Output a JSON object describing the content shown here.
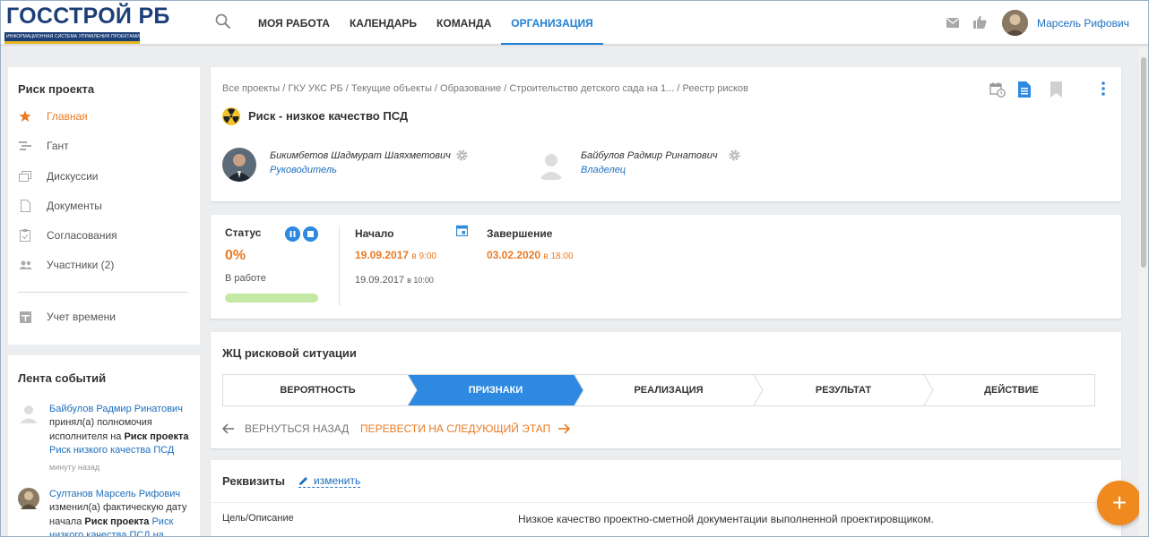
{
  "header": {
    "logo_title": "ГОССТРОЙ РБ",
    "logo_subtitle": "ИНФОРМАЦИОННАЯ СИСТЕМА УПРАВЛЕНИЯ ПРОЕКТАМИ",
    "nav": [
      {
        "label": "Моя работа"
      },
      {
        "label": "Календарь"
      },
      {
        "label": "Команда"
      },
      {
        "label": "Организация",
        "active": true
      }
    ],
    "user_name": "Марсель Рифович"
  },
  "sidebar": {
    "title": "Риск проекта",
    "items": [
      {
        "label": "Главная",
        "icon": "star-icon",
        "active": true
      },
      {
        "label": "Гант",
        "icon": "gantt-icon"
      },
      {
        "label": "Дискуссии",
        "icon": "discussions-icon"
      },
      {
        "label": "Документы",
        "icon": "documents-icon"
      },
      {
        "label": "Согласования",
        "icon": "approvals-icon"
      },
      {
        "label": "Участники (2)",
        "icon": "participants-icon"
      }
    ],
    "time_item": {
      "label": "Учет времени",
      "icon": "time-tracking-icon"
    }
  },
  "feed": {
    "title": "Лента событий",
    "items": [
      {
        "author": "Байбулов Радмир Ринатович",
        "action": "принял(а) полномочия исполнителя на",
        "object_type": "Риск проекта",
        "object": "Риск низкого качества ПСД",
        "time": "минуту назад"
      },
      {
        "author": "Султанов Марсель Рифович",
        "action": "изменил(а) фактическую дату начала",
        "object_type": "Риск проекта",
        "object": "Риск низкого качества ПСД на"
      }
    ]
  },
  "main": {
    "breadcrumb": "Все проекты / ГКУ УКС РБ / Текущие объекты / Образование / Строительство детского сада на 1... / Реестр рисков",
    "title": "Риск - низкое качество ПСД",
    "people": [
      {
        "name": "Бикимбетов Шадмурат Шаяхметович",
        "role": "Руководитель"
      },
      {
        "name": "Байбулов Радмир Ринатович",
        "role": "Владелец"
      }
    ],
    "status": {
      "label": "Статус",
      "percent": "0%",
      "progress": 0,
      "state": "В работе"
    },
    "start": {
      "label": "Начало",
      "plan_date": "19.09.2017",
      "plan_time": "в 9:00",
      "fact_date": "19.09.2017",
      "fact_time": "в 10:00"
    },
    "end": {
      "label": "Завершение",
      "plan_date": "03.02.2020",
      "plan_time": "в 18:00"
    },
    "lifecycle": {
      "title": "ЖЦ рисковой ситуации",
      "stages": [
        "Вероятность",
        "Признаки",
        "Реализация",
        "Результат",
        "Действие"
      ],
      "active_index": 1,
      "back_label": "Вернуться назад",
      "next_label": "Перевести на следующий этап"
    },
    "requisites": {
      "title": "Реквизиты",
      "edit_label": "изменить",
      "rows": [
        {
          "label": "Цель/Описание",
          "value": "Низкое качество проектно-сметной документации выполненной проектировщиком."
        }
      ]
    }
  },
  "fab_label": "+",
  "colors": {
    "brand": "#1d3f78",
    "accent": "#1e7ed4",
    "orange": "#e97b25",
    "progress": "#8fd25c"
  }
}
